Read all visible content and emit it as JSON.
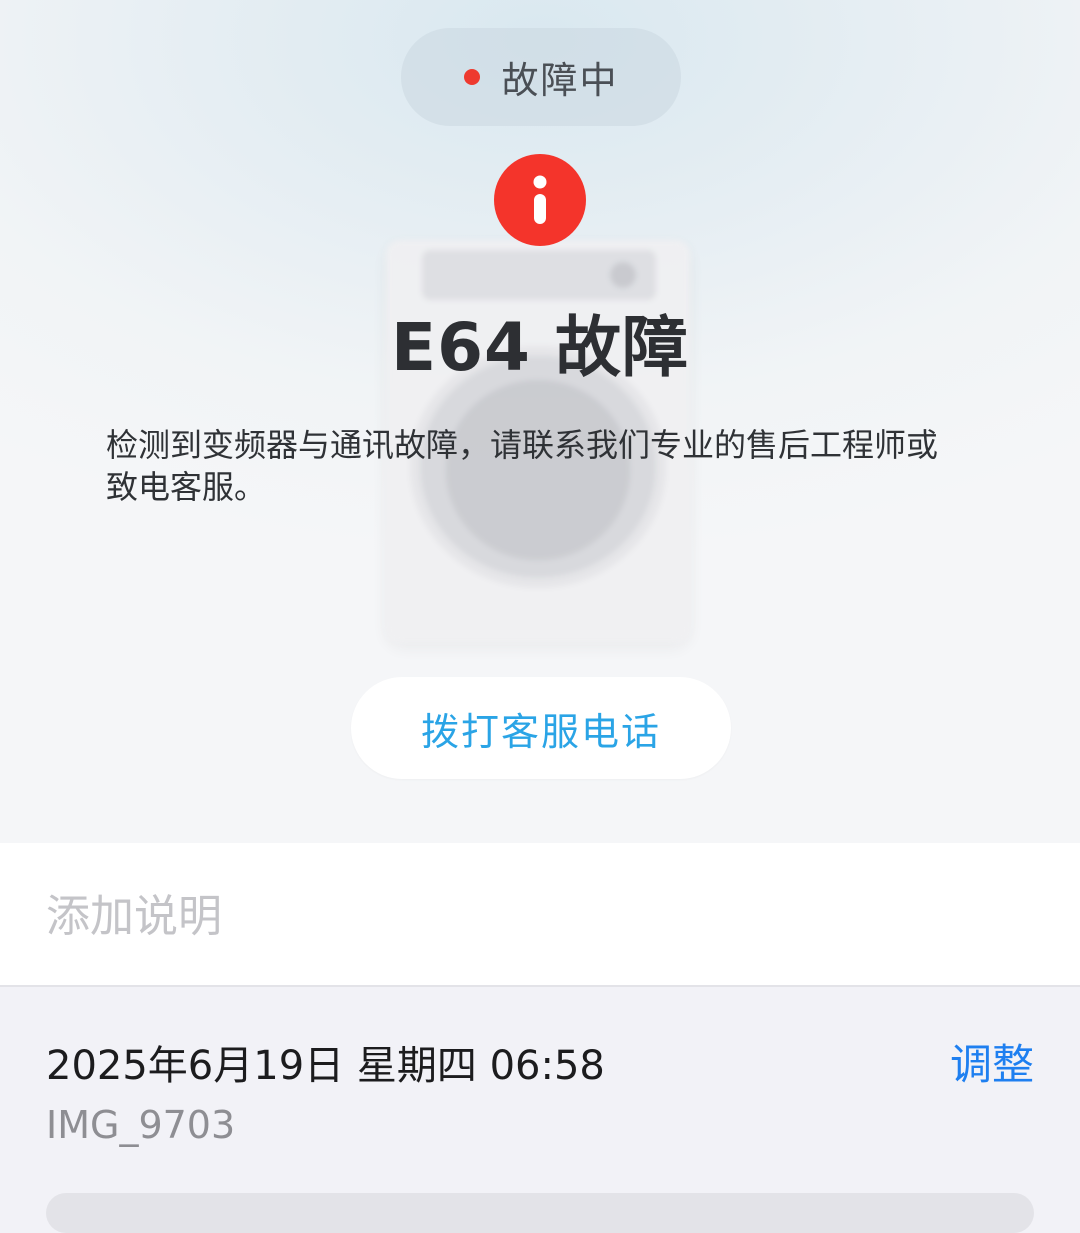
{
  "status": {
    "label": "故障中",
    "dot_color": "#ee3a2f"
  },
  "alert": {
    "icon": "info-icon",
    "color": "#f4342b"
  },
  "fault": {
    "title": "E64 故障",
    "description": "检测到变频器与通讯故障，请联系我们专业的售后工程师或致电客服。"
  },
  "actions": {
    "call_label": "拨打客服电话",
    "call_color": "#2aa4e6"
  },
  "caption": {
    "placeholder": "添加说明",
    "value": ""
  },
  "photo_info": {
    "datetime": "2025年6月19日 星期四 06:58",
    "adjust_label": "调整",
    "filename": "IMG_9703",
    "accent_color": "#1e7ff0"
  }
}
